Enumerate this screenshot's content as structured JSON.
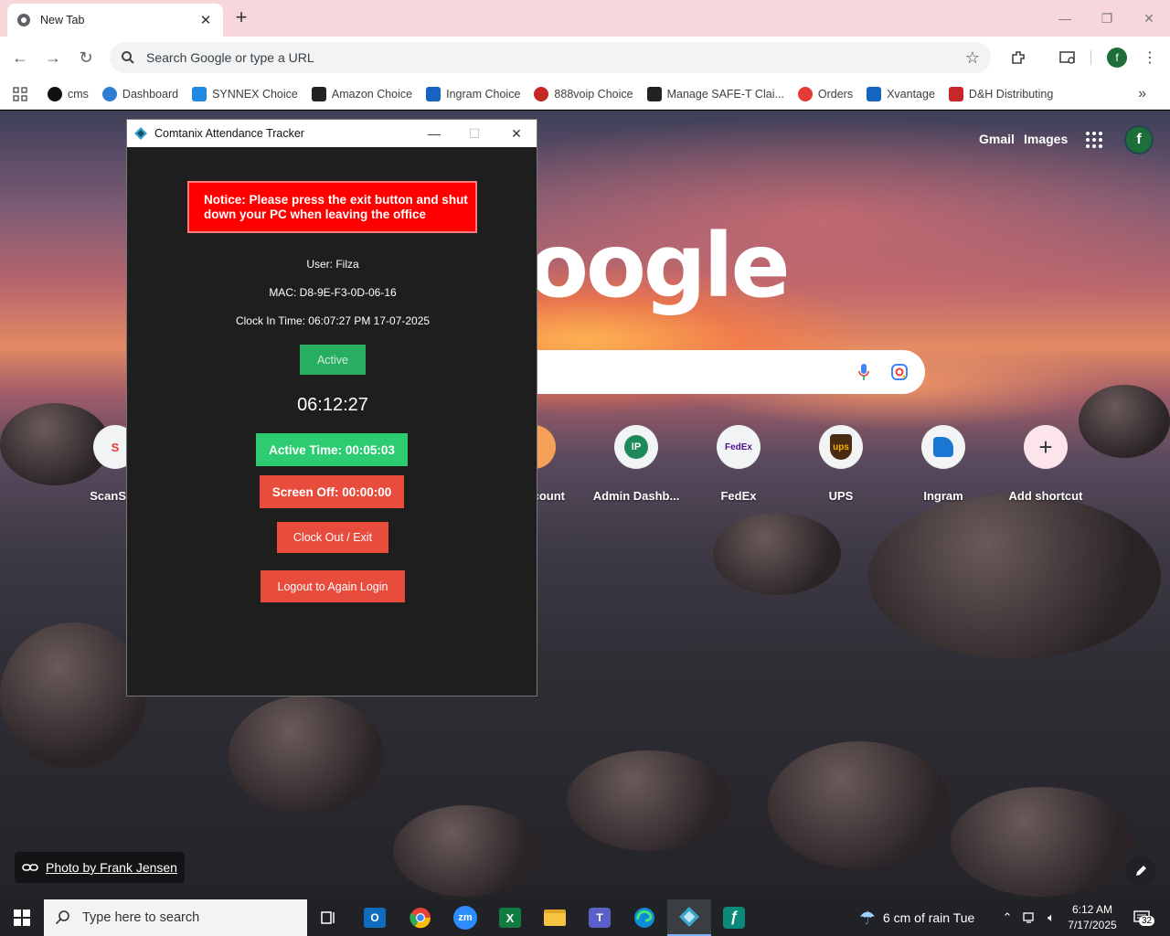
{
  "browser": {
    "tab_title": "New Tab",
    "omnibox_placeholder": "Search Google or type a URL",
    "profile_initial": "f",
    "bookmarks": [
      {
        "label": "cms",
        "color": "#111111"
      },
      {
        "label": "Dashboard",
        "color": "#2d7dd2"
      },
      {
        "label": "SYNNEX Choice",
        "color": "#1e88e5"
      },
      {
        "label": "Amazon Choice",
        "color": "#222222"
      },
      {
        "label": "Ingram Choice",
        "color": "#1565c0"
      },
      {
        "label": "888voip Choice",
        "color": "#c62828"
      },
      {
        "label": "Manage SAFE-T Clai...",
        "color": "#222222"
      },
      {
        "label": "Orders",
        "color": "#e53935"
      },
      {
        "label": "Xvantage",
        "color": "#1565c0"
      },
      {
        "label": "D&H Distributing",
        "color": "#c62828"
      }
    ]
  },
  "ntp": {
    "gmail": "Gmail",
    "images": "Images",
    "logo_text": "oogle",
    "avatar_initial": "f",
    "shortcuts": [
      {
        "label": "ScanS",
        "icon": "scan-icon"
      },
      {
        "label": "count",
        "icon": "account-icon"
      },
      {
        "label": "Admin Dashb...",
        "icon": "ip-icon",
        "glyph": "IP"
      },
      {
        "label": "FedEx",
        "icon": "fedex-icon",
        "glyph": "FedEx"
      },
      {
        "label": "UPS",
        "icon": "ups-icon",
        "glyph": "ups"
      },
      {
        "label": "Ingram",
        "icon": "ingram-icon"
      },
      {
        "label": "Add shortcut",
        "icon": "plus-icon",
        "glyph": "+"
      }
    ],
    "photo_credit": "Photo by Frank Jensen"
  },
  "tracker": {
    "window_title": "Comtanix Attendance Tracker",
    "notice": "Notice: Please press the exit button and shut down your PC when leaving the office",
    "user": "User: Filza",
    "mac": "MAC: D8-9E-F3-0D-06-16",
    "clock_in": "Clock In Time: 06:07:27 PM 17-07-2025",
    "status": "Active",
    "current_time": "06:12:27",
    "active_time": "Active Time: 00:05:03",
    "screen_off": "Screen Off: 00:00:00",
    "clock_out_label": "Clock Out / Exit",
    "logout_label": "Logout to Again Login"
  },
  "taskbar": {
    "search_placeholder": "Type here to search",
    "weather": "6 cm of rain Tue",
    "time": "6:12 AM",
    "date": "7/17/2025",
    "notifications": "32"
  },
  "colors": {
    "notice_bg": "#ff0000",
    "active_green": "#27ae60",
    "active_time_green": "#2ecc71",
    "button_red": "#e74c3c",
    "tab_strip": "#f8d7dc"
  }
}
